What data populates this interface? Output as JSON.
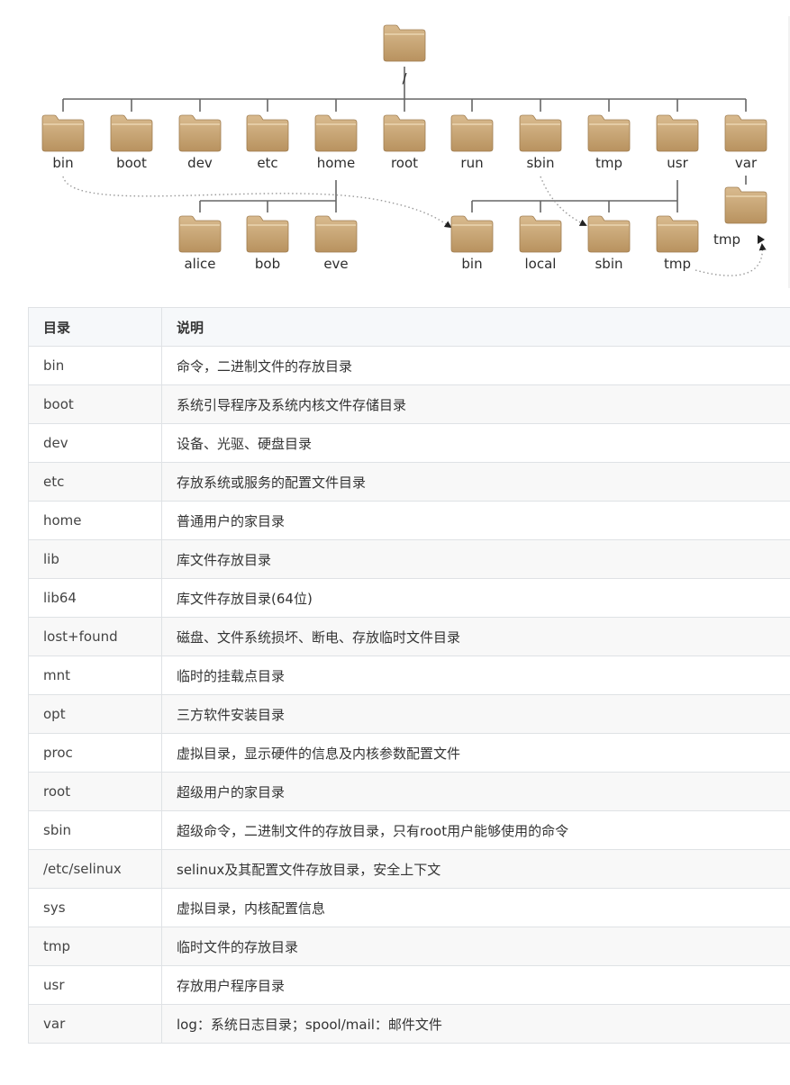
{
  "tree": {
    "root_label": "/",
    "top_level": [
      "bin",
      "boot",
      "dev",
      "etc",
      "home",
      "root",
      "run",
      "sbin",
      "tmp",
      "usr",
      "var"
    ],
    "home_children": [
      "alice",
      "bob",
      "eve"
    ],
    "usr_children": [
      "bin",
      "local",
      "sbin",
      "tmp"
    ],
    "var_children": [
      "tmp"
    ],
    "folder_color": "#c9a77a",
    "line_color": "#666666"
  },
  "table": {
    "headers": [
      "目录",
      "说明"
    ],
    "rows": [
      [
        "bin",
        "命令，二进制文件的存放目录"
      ],
      [
        "boot",
        "系统引导程序及系统内核文件存储目录"
      ],
      [
        "dev",
        "设备、光驱、硬盘目录"
      ],
      [
        "etc",
        "存放系统或服务的配置文件目录"
      ],
      [
        "home",
        "普通用户的家目录"
      ],
      [
        "lib",
        "库文件存放目录"
      ],
      [
        "lib64",
        "库文件存放目录(64位)"
      ],
      [
        "lost+found",
        "磁盘、文件系统损坏、断电、存放临时文件目录"
      ],
      [
        "mnt",
        "临时的挂载点目录"
      ],
      [
        "opt",
        "三方软件安装目录"
      ],
      [
        "proc",
        "虚拟目录，显示硬件的信息及内核参数配置文件"
      ],
      [
        "root",
        "超级用户的家目录"
      ],
      [
        "sbin",
        "超级命令，二进制文件的存放目录，只有root用户能够使用的命令"
      ],
      [
        "/etc/selinux",
        "selinux及其配置文件存放目录，安全上下文"
      ],
      [
        "sys",
        "虚拟目录，内核配置信息"
      ],
      [
        "tmp",
        "临时文件的存放目录"
      ],
      [
        "usr",
        "存放用户程序目录"
      ],
      [
        "var",
        "log：系统日志目录；spool/mail：邮件文件"
      ]
    ]
  }
}
